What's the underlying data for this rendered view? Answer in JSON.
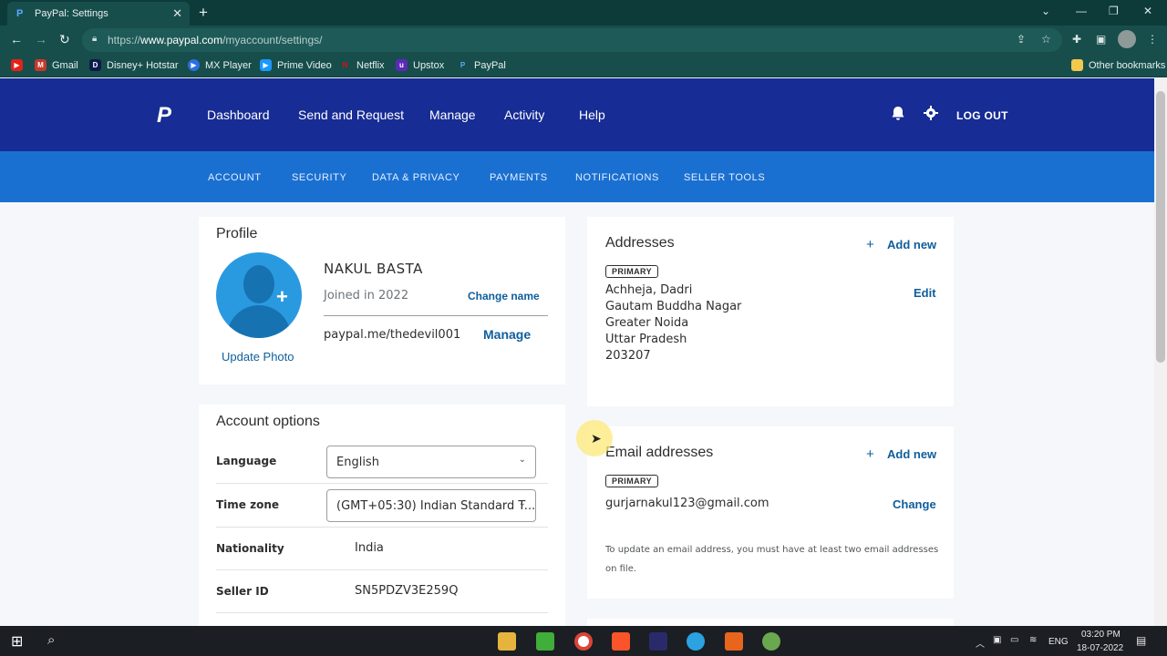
{
  "browser": {
    "tab_title": "PayPal: Settings",
    "new_tab": "+",
    "url_scheme": "https://",
    "url_host": "www.paypal.com",
    "url_path": "/myaccount/settings/",
    "bookmarks": [
      "Gmail",
      "Disney+ Hotstar",
      "MX Player",
      "Prime Video",
      "Netflix",
      "Upstox",
      "PayPal"
    ],
    "other_bookmarks": "Other bookmarks"
  },
  "header": {
    "logo": "P",
    "nav": [
      "Dashboard",
      "Send and Request",
      "Manage",
      "Activity",
      "Help"
    ],
    "logout": "LOG OUT"
  },
  "subnav": [
    "ACCOUNT",
    "SECURITY",
    "DATA & PRIVACY",
    "PAYMENTS",
    "NOTIFICATIONS",
    "SELLER TOOLS"
  ],
  "profile": {
    "title": "Profile",
    "name": "NAKUL BASTA",
    "joined": "Joined in 2022",
    "change_name": "Change name",
    "paypal_me": "paypal.me/thedevil001",
    "manage": "Manage",
    "update_photo": "Update Photo"
  },
  "account_options": {
    "title": "Account options",
    "language_label": "Language",
    "language_value": "English",
    "timezone_label": "Time zone",
    "timezone_value": "(GMT+05:30) Indian Standard T...",
    "nationality_label": "Nationality",
    "nationality_value": "India",
    "seller_id_label": "Seller ID",
    "seller_id_value": "SN5PDZV3E259Q"
  },
  "addresses": {
    "title": "Addresses",
    "add_new": "Add new",
    "badge": "PRIMARY",
    "lines": [
      "Achheja, Dadri",
      "Gautam Buddha Nagar",
      "Greater Noida",
      "Uttar Pradesh",
      "203207"
    ],
    "edit": "Edit"
  },
  "emails": {
    "title": "Email addresses",
    "add_new": "Add new",
    "badge": "PRIMARY",
    "email": "gurjarnakul123@gmail.com",
    "change": "Change",
    "note": "To update an email address, you must have at least two email addresses on file."
  },
  "taskbar": {
    "lang": "ENG",
    "time": "03:20 PM",
    "date": "18-07-2022"
  }
}
